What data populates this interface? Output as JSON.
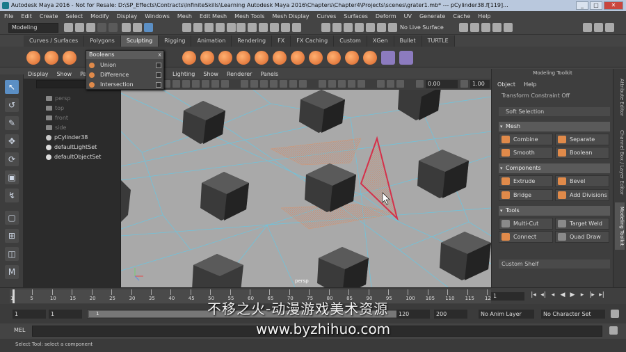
{
  "window": {
    "title": "Autodesk Maya 2016 - Not for Resale: D:\\SP_Effects\\Contracts\\InfiniteSkills\\Learning Autodesk Maya 2016\\Chapters\\Chapter4\\Projects\\scenes\\grater1.mb* --- pCylinder38.f[119]...",
    "min": "_",
    "max": "□",
    "close": "✕"
  },
  "menubar": [
    "File",
    "Edit",
    "Create",
    "Select",
    "Modify",
    "Display",
    "Windows",
    "Mesh",
    "Edit Mesh",
    "Mesh Tools",
    "Mesh Display",
    "Curves",
    "Surfaces",
    "Deform",
    "UV",
    "Generate",
    "Cache",
    "Help"
  ],
  "statusline": {
    "mode": "Modeling",
    "live_surface": "No Live Surface"
  },
  "shelf_tabs": [
    "Curves / Surfaces",
    "Polygons",
    "Sculpting",
    "Rigging",
    "Animation",
    "Rendering",
    "FX",
    "FX Caching",
    "Custom",
    "XGen",
    "Bullet",
    "TURTLE"
  ],
  "shelf_active": "Sculpting",
  "booleans": {
    "title": "Booleans",
    "close": "x",
    "items": [
      "Union",
      "Difference",
      "Intersection"
    ]
  },
  "outliner": {
    "menu": [
      "Display",
      "Show",
      "Panel"
    ],
    "items": [
      {
        "label": "persp",
        "dim": true
      },
      {
        "label": "top",
        "dim": true
      },
      {
        "label": "front",
        "dim": true
      },
      {
        "label": "side",
        "dim": true
      },
      {
        "label": "pCylinder38",
        "dim": false
      },
      {
        "label": "defaultLightSet",
        "dim": false
      },
      {
        "label": "defaultObjectSet",
        "dim": false
      }
    ]
  },
  "panel": {
    "menu": [
      "Lighting",
      "Show",
      "Renderer",
      "Panels"
    ],
    "field1": "0.00",
    "field2": "1.00",
    "camera_label": "persp"
  },
  "modeling_toolkit": {
    "title": "Modeling Toolkit",
    "menu": [
      "Object",
      "Help"
    ],
    "transform_constraint": "Transform Constraint    Off",
    "soft_selection": "Soft Selection",
    "sections": {
      "mesh": "Mesh",
      "components": "Components",
      "tools": "Tools"
    },
    "mesh_buttons": [
      "Combine",
      "Separate",
      "Smooth",
      "Boolean"
    ],
    "component_buttons": [
      "Extrude",
      "Bevel",
      "Bridge",
      "Add Divisions"
    ],
    "tool_buttons": [
      "Multi-Cut",
      "Target Weld",
      "Connect",
      "Quad Draw"
    ],
    "custom_shelf": "Custom Shelf"
  },
  "side_tabs": [
    "Attribute Editor",
    "Channel Box / Layer Editor",
    "Modeling Toolkit"
  ],
  "timeline": {
    "ticks": [
      "1",
      "5",
      "10",
      "15",
      "20",
      "25",
      "30",
      "35",
      "40",
      "45",
      "50",
      "55",
      "60",
      "65",
      "70",
      "75",
      "80",
      "85",
      "90",
      "95",
      "100",
      "105",
      "110",
      "115",
      "120"
    ],
    "current_frame": "1",
    "play_buttons": [
      "|◂",
      "◂|",
      "◂",
      "◀",
      "▶",
      "▸",
      "|▸",
      "▸|"
    ]
  },
  "range": {
    "start": "1",
    "start2": "1",
    "slider_label": "1",
    "end": "120",
    "end2": "200",
    "anim_layer": "No Anim Layer",
    "char_set": "No Character Set"
  },
  "command": {
    "label": "MEL"
  },
  "help_line": "Select Tool: select a component",
  "watermark": {
    "line1": "不移之火-动漫游戏美术资源",
    "line2": "www.byzhihuo.com"
  }
}
